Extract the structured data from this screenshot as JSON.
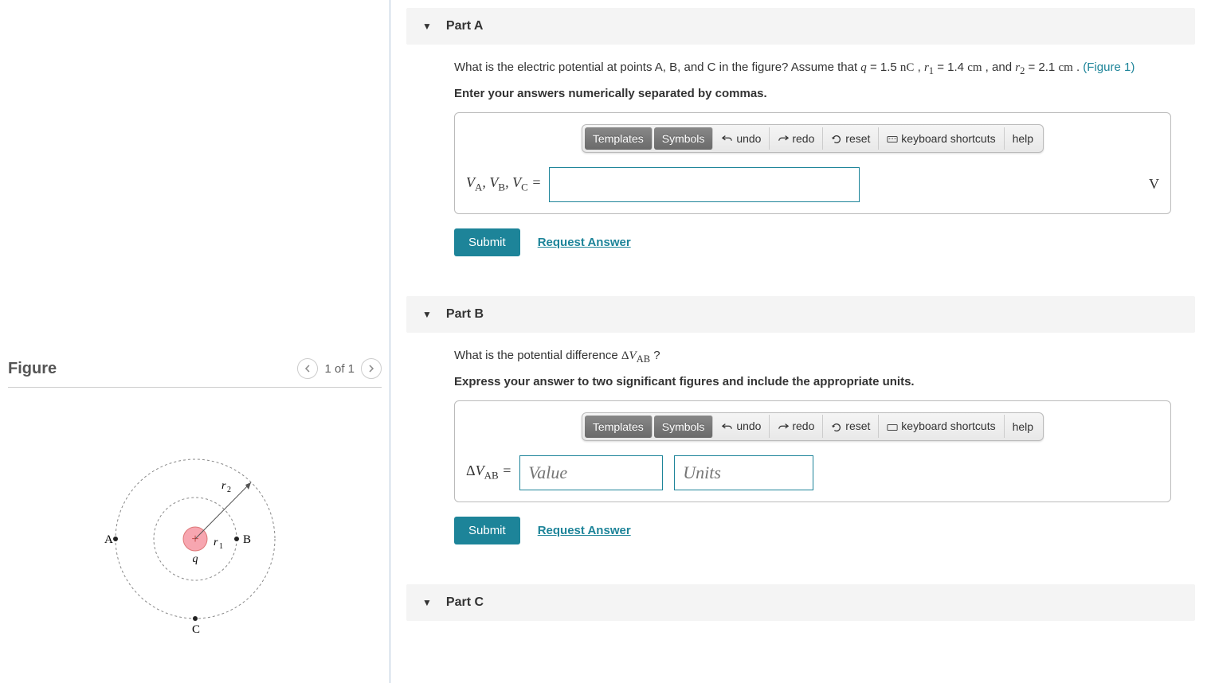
{
  "figure": {
    "title": "Figure",
    "nav_text": "1 of 1",
    "labels": {
      "A": "A",
      "B": "B",
      "C": "C",
      "q": "q",
      "r1": "r",
      "r1sub": "1",
      "r2": "r",
      "r2sub": "2"
    }
  },
  "toolbar": {
    "templates": "Templates",
    "symbols": "Symbols",
    "undo": "undo",
    "redo": "redo",
    "reset": "reset",
    "shortcuts": "keyboard shortcuts",
    "help": "help"
  },
  "common": {
    "submit": "Submit",
    "request": "Request Answer",
    "figure_link": "(Figure 1)"
  },
  "parts": {
    "A": {
      "title": "Part A",
      "question_prefix": "What is the electric potential at points A, B, and C in the figure? Assume that ",
      "q_val": "1.5",
      "q_unit": "nC",
      "r1_val": "1.4",
      "r1_unit": "cm",
      "r2_val": "2.1",
      "r2_unit": "cm",
      "instruction": "Enter your answers numerically separated by commas.",
      "answer_label_parts": {
        "V": "V",
        "A": "A",
        "B": "B",
        "C": "C",
        "eq": " = "
      },
      "unit": "V"
    },
    "B": {
      "title": "Part B",
      "question": "What is the potential difference ",
      "qmark": "?",
      "instruction": "Express your answer to two significant figures and include the appropriate units.",
      "answer_label_delta": "Δ",
      "answer_label_V": "V",
      "answer_label_sub": "AB",
      "eq": " = ",
      "value_ph": "Value",
      "units_ph": "Units"
    },
    "C": {
      "title": "Part C"
    }
  }
}
